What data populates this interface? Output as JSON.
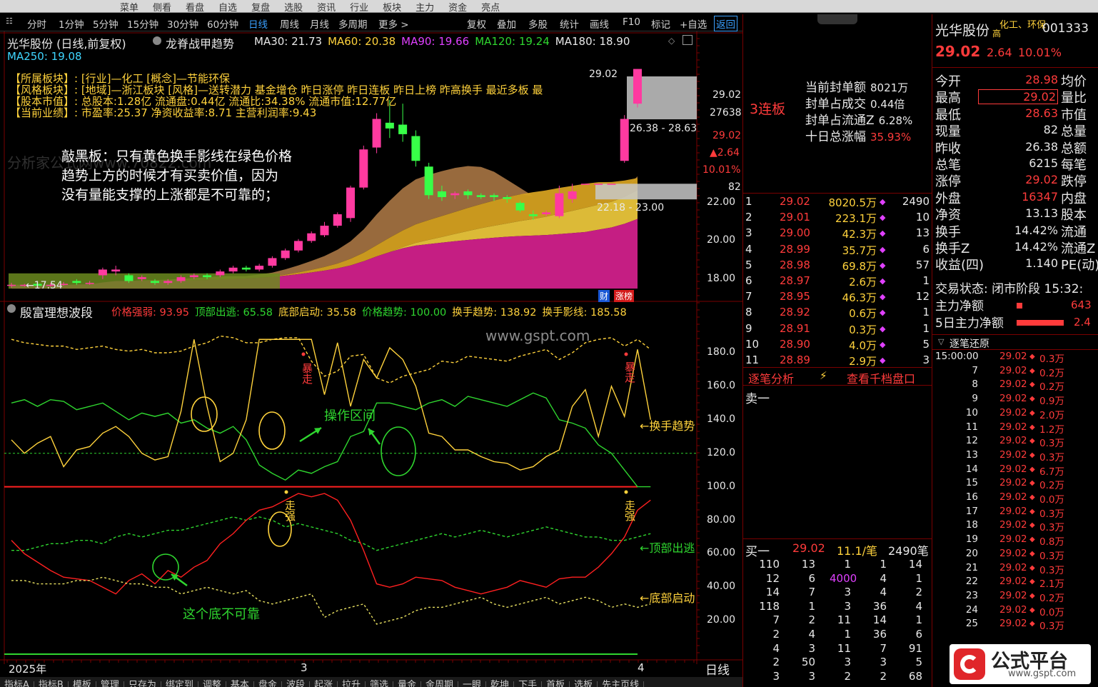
{
  "top_menu": [
    "菜单",
    "侧看",
    "看盘",
    "自选",
    "复盘",
    "选股",
    "资讯",
    "行业",
    "板块",
    "主力",
    "资金",
    "亮点"
  ],
  "period_bar": {
    "periods": [
      "分时",
      "1分钟",
      "5分钟",
      "15分钟",
      "30分钟",
      "60分钟",
      "日线",
      "周线",
      "月线",
      "多周期",
      "更多 >"
    ],
    "active": "日线",
    "tools": [
      "复权",
      "叠加",
      "多股",
      "统计",
      "画线",
      "F10",
      "标记",
      "+自选",
      "返回"
    ]
  },
  "chart_header": {
    "stock_title": "光华股份 (日线,前复权)",
    "indicator_name": "龙脊战甲趋势",
    "ma_values": [
      {
        "label": "MA30: 21.73",
        "color": "#e8e8e8"
      },
      {
        "label": "MA60: 20.38",
        "color": "#ffd23c"
      },
      {
        "label": "MA90: 19.66",
        "color": "#e040ff"
      },
      {
        "label": "MA120: 19.24",
        "color": "#2fd62f"
      },
      {
        "label": "MA180: 18.90",
        "color": "#e8e8e8"
      }
    ],
    "ma250": "MA250: 19.08"
  },
  "info_box": {
    "lines": [
      "【所属板块】: [行业]—化工 [概念]—节能环保",
      "【风格板块】: [地域]—浙江板块 [风格]—送转潜力 基金增仓 昨日涨停 昨日连板 昨日上榜 昨高换手 最近多板 最",
      "【股本市值】: 总股本:1.28亿 流通盘:0.44亿 流通比:34.38% 流通市值:12.77亿",
      "【当前业绩】: 市盈率:25.37 净资收益率:8.71 主营利润率:9.43"
    ]
  },
  "annotation_main": [
    "敲黑板：只有黄色换手影线在绿色价格",
    "趋势上方的时候才有买卖价值，因为",
    "没有量能支撑的上涨都是不可靠的；"
  ],
  "price_chart": {
    "high_label": "29.02",
    "low_label": "17.54",
    "zone1_label": "26.38 - 28.63",
    "zone2_label": "22.18 - 23.00",
    "axis": [
      "22.00",
      "20.00",
      "18.00"
    ],
    "right_labels": {
      "price": "29.02",
      "vol": "27638",
      "cur": "29.02",
      "chg": "▲2.64",
      "pct": "10.01%",
      "v82": "82"
    },
    "badge_cai": "财",
    "badge_zb": "涨榜",
    "candles": [
      {
        "o": 17.7,
        "c": 17.7,
        "h": 17.8,
        "l": 17.55
      },
      {
        "o": 17.7,
        "c": 17.7,
        "h": 17.75,
        "l": 17.6
      },
      {
        "o": 17.75,
        "c": 17.65,
        "h": 17.85,
        "l": 17.6
      },
      {
        "o": 17.7,
        "c": 17.7,
        "h": 17.8,
        "l": 17.6
      },
      {
        "o": 17.7,
        "c": 17.75,
        "h": 17.85,
        "l": 17.65
      },
      {
        "o": 17.9,
        "c": 17.8,
        "h": 18.0,
        "l": 17.7
      },
      {
        "o": 17.8,
        "c": 17.8,
        "h": 17.9,
        "l": 17.7
      },
      {
        "o": 18.2,
        "c": 18.5,
        "h": 18.6,
        "l": 18.0
      },
      {
        "o": 18.4,
        "c": 18.5,
        "h": 18.7,
        "l": 18.2
      },
      {
        "o": 18.2,
        "c": 17.9,
        "h": 18.3,
        "l": 17.8
      },
      {
        "o": 18.0,
        "c": 18.1,
        "h": 18.2,
        "l": 17.9
      },
      {
        "o": 17.9,
        "c": 17.8,
        "h": 18.0,
        "l": 17.7
      },
      {
        "o": 17.8,
        "c": 17.9,
        "h": 18.0,
        "l": 17.7
      },
      {
        "o": 17.9,
        "c": 18.1,
        "h": 18.2,
        "l": 17.8
      },
      {
        "o": 18.1,
        "c": 18.2,
        "h": 18.3,
        "l": 18.0
      },
      {
        "o": 18.2,
        "c": 18.1,
        "h": 18.3,
        "l": 18.0
      },
      {
        "o": 18.2,
        "c": 18.4,
        "h": 18.5,
        "l": 18.1
      },
      {
        "o": 18.4,
        "c": 18.6,
        "h": 18.7,
        "l": 18.3
      },
      {
        "o": 18.6,
        "c": 18.5,
        "h": 18.7,
        "l": 18.4
      },
      {
        "o": 18.5,
        "c": 18.7,
        "h": 18.8,
        "l": 18.4
      },
      {
        "o": 18.7,
        "c": 19.1,
        "h": 19.2,
        "l": 18.6
      },
      {
        "o": 19.1,
        "c": 19.5,
        "h": 19.6,
        "l": 19.0
      },
      {
        "o": 19.5,
        "c": 20.0,
        "h": 20.1,
        "l": 19.4
      },
      {
        "o": 20.0,
        "c": 20.4,
        "h": 20.5,
        "l": 19.9
      },
      {
        "o": 20.3,
        "c": 20.8,
        "h": 21.0,
        "l": 20.2
      },
      {
        "o": 20.8,
        "c": 21.4,
        "h": 21.5,
        "l": 20.7
      },
      {
        "o": 21.2,
        "c": 22.8,
        "h": 22.9,
        "l": 21.0
      },
      {
        "o": 22.8,
        "c": 24.8,
        "h": 25.0,
        "l": 22.7
      },
      {
        "o": 24.9,
        "c": 26.4,
        "h": 26.7,
        "l": 24.6
      },
      {
        "o": 26.2,
        "c": 25.9,
        "h": 27.4,
        "l": 25.4
      },
      {
        "o": 26.1,
        "c": 25.6,
        "h": 27.2,
        "l": 25.2
      },
      {
        "o": 25.5,
        "c": 24.2,
        "h": 25.8,
        "l": 23.9
      },
      {
        "o": 23.9,
        "c": 22.4,
        "h": 24.1,
        "l": 22.2
      },
      {
        "o": 22.6,
        "c": 22.3,
        "h": 22.9,
        "l": 22.1
      },
      {
        "o": 22.4,
        "c": 22.5,
        "h": 22.6,
        "l": 22.2
      },
      {
        "o": 22.6,
        "c": 22.4,
        "h": 22.7,
        "l": 22.2
      },
      {
        "o": 22.4,
        "c": 22.3,
        "h": 22.5,
        "l": 22.2
      },
      {
        "o": 22.4,
        "c": 22.3,
        "h": 22.5,
        "l": 22.1
      },
      {
        "o": 22.3,
        "c": 22.2,
        "h": 22.4,
        "l": 22.0
      },
      {
        "o": 22.0,
        "c": 21.6,
        "h": 22.1,
        "l": 21.5
      },
      {
        "o": 21.4,
        "c": 21.3,
        "h": 21.6,
        "l": 21.1
      },
      {
        "o": 21.4,
        "c": 21.5,
        "h": 21.6,
        "l": 21.3
      },
      {
        "o": 21.3,
        "c": 22.5,
        "h": 22.9,
        "l": 21.2
      },
      {
        "o": 22.2,
        "c": 22.6,
        "h": 23.0,
        "l": 22.0
      },
      {
        "o": 23.0,
        "c": 23.0,
        "h": 23.0,
        "l": 23.0
      },
      {
        "o": 23.0,
        "c": 23.0,
        "h": 23.0,
        "l": 23.0
      },
      {
        "o": 23.0,
        "c": 23.0,
        "h": 23.0,
        "l": 23.0
      },
      {
        "o": 24.2,
        "c": 26.4,
        "h": 26.6,
        "l": 24.1
      },
      {
        "o": 27.2,
        "c": 29.02,
        "h": 29.02,
        "l": 27.0
      }
    ]
  },
  "osc_chart": {
    "title": "殷富理想波段",
    "items": [
      {
        "label": "价格强弱: 93.95",
        "color": "#ff3b3b"
      },
      {
        "label": "顶部出逃: 65.58",
        "color": "#2fd62f"
      },
      {
        "label": "底部启动: 35.58",
        "color": "#ffd23c"
      },
      {
        "label": "价格趋势: 100.00",
        "color": "#2fd62f"
      },
      {
        "label": "换手趋势: 138.92",
        "color": "#ffd23c"
      },
      {
        "label": "换手影线: 185.58",
        "color": "#ffd23c"
      }
    ],
    "axis": [
      "180.0",
      "160.0",
      "140.0",
      "120.0",
      "100.0",
      "80.00",
      "60.00",
      "40.00",
      "20.00"
    ],
    "right_labels": {
      "hs": "←换手趋势",
      "ding": "←顶部出逃",
      "di": "←底部启动"
    },
    "notes": {
      "op_zone": "操作区间",
      "unreliable": "这个底不可靠",
      "baozou": "暴走",
      "zouqiang": "走强"
    },
    "series_yellow": [
      128,
      120,
      126,
      130,
      112,
      122,
      124,
      132,
      136,
      130,
      120,
      116,
      118,
      145,
      188,
      148,
      115,
      120,
      140,
      188,
      188,
      188,
      188,
      188,
      155,
      186,
      148,
      176,
      165,
      183,
      176,
      160,
      132,
      130,
      122,
      122,
      118,
      115,
      114,
      110,
      112,
      118,
      122,
      148,
      158,
      130,
      160,
      142,
      182,
      140
    ],
    "series_green": [
      150,
      152,
      148,
      152,
      151,
      146,
      148,
      150,
      145,
      140,
      144,
      142,
      144,
      138,
      140,
      135,
      132,
      136,
      128,
      113,
      108,
      104,
      110,
      108,
      112,
      115,
      130,
      133,
      150,
      150,
      148,
      146,
      150,
      152,
      148,
      154,
      152,
      150,
      148,
      152,
      156,
      153,
      140,
      138,
      135,
      125,
      120,
      110,
      100,
      100
    ],
    "series_yellow_dash": [
      188,
      186,
      185,
      184,
      184,
      182,
      183,
      184,
      182,
      181,
      182,
      180,
      180,
      181,
      184,
      186,
      190,
      189,
      186,
      186,
      188,
      189,
      189,
      175,
      166,
      169,
      178,
      179,
      165,
      162,
      166,
      168,
      170,
      175,
      174,
      178,
      177,
      176,
      175,
      178,
      180,
      182,
      176,
      180,
      186,
      188,
      189,
      184,
      188,
      182
    ],
    "series_red": [
      68,
      60,
      55,
      50,
      46,
      45,
      44,
      40,
      36,
      44,
      48,
      42,
      50,
      46,
      52,
      56,
      66,
      72,
      80,
      86,
      88,
      92,
      96,
      94,
      96,
      92,
      80,
      62,
      42,
      40,
      42,
      46,
      45,
      44,
      40,
      38,
      36,
      38,
      40,
      44,
      42,
      40,
      45,
      46,
      46,
      52,
      60,
      70,
      86,
      92
    ],
    "series_green_dash": [
      62,
      62,
      64,
      66,
      66,
      68,
      68,
      66,
      70,
      72,
      70,
      72,
      74,
      74,
      76,
      78,
      80,
      82,
      80,
      82,
      80,
      76,
      78,
      76,
      74,
      72,
      68,
      66,
      62,
      64,
      66,
      68,
      70,
      72,
      70,
      72,
      74,
      72,
      70,
      72,
      74,
      76,
      74,
      72,
      70,
      70,
      68,
      68,
      70,
      72
    ],
    "series_white_dash": [
      44,
      44,
      42,
      42,
      42,
      44,
      44,
      46,
      44,
      42,
      42,
      40,
      40,
      36,
      38,
      40,
      38,
      36,
      38,
      32,
      30,
      32,
      34,
      36,
      22,
      26,
      28,
      30,
      18,
      20,
      22,
      26,
      28,
      28,
      30,
      32,
      34,
      30,
      28,
      30,
      32,
      34,
      30,
      32,
      34,
      32,
      28,
      30,
      28,
      30
    ]
  },
  "x_axis": {
    "labels": [
      "2025年",
      "3",
      "4"
    ],
    "right": "日线"
  },
  "bottom_tabs": [
    "指标A",
    "指标B",
    "模板",
    "管理",
    "只存为",
    "绑定到",
    "调整",
    "基本",
    "盘金",
    "波段",
    "起涨",
    "拉升",
    "筛选",
    "量金",
    "金周期",
    "一眼",
    "乾坤",
    "下手",
    "首板",
    "选板",
    "先主页线"
  ],
  "right_panel": {
    "stock_name": "光华股份",
    "tags": "化工、环保",
    "tag_sub": "高",
    "code": "001333",
    "price": "29.02",
    "change": "2.64",
    "pct": "10.01%",
    "limit_board": "3连板",
    "seal_info": [
      {
        "k": "当前封单额",
        "v": "8021万"
      },
      {
        "k": "封单占成交",
        "v": "0.44倍"
      },
      {
        "k": "封单占流通Z",
        "v": "6.28%"
      },
      {
        "k": "十日总涨幅",
        "v": "35.93%"
      }
    ],
    "quotes_left": [
      {
        "k": "今开",
        "v": "28.98",
        "c": "red"
      },
      {
        "k": "最高",
        "v": "29.02",
        "c": "red"
      },
      {
        "k": "最低",
        "v": "28.63",
        "c": "red"
      },
      {
        "k": "现量",
        "v": "82",
        "c": "white"
      },
      {
        "k": "昨收",
        "v": "26.38",
        "c": "white"
      },
      {
        "k": "总笔",
        "v": "6215",
        "c": "white"
      },
      {
        "k": "涨停",
        "v": "29.02",
        "c": "red"
      },
      {
        "k": "外盘",
        "v": "16347",
        "c": "red"
      },
      {
        "k": "净资",
        "v": "13.13",
        "c": "white"
      },
      {
        "k": "换手",
        "v": "14.42%",
        "c": "white"
      },
      {
        "k": "换手Z",
        "v": "14.42%",
        "c": "white"
      },
      {
        "k": "收益(四)",
        "v": "1.140",
        "c": "white"
      }
    ],
    "quotes_right": [
      "均价",
      "量比",
      "市值",
      "总量",
      "总额",
      "每笔",
      "跌停",
      "内盘",
      "股本",
      "流通",
      "流通Z",
      "PE(动)"
    ],
    "trade_status": "交易状态: 闭市阶段 15:32:",
    "main_net": "主力净额",
    "main_net_val": "643",
    "main5_net": "5日主力净额",
    "main5_net_val": "2.4",
    "tick_title": "逐笔还原",
    "ticks": [
      {
        "t": "15:00:00",
        "p": "29.02",
        "v": "0.3万"
      },
      {
        "t": "7",
        "p": "29.02",
        "v": "0.2万"
      },
      {
        "t": "8",
        "p": "29.02",
        "v": "0.2万"
      },
      {
        "t": "9",
        "p": "29.02",
        "v": "0.9万"
      },
      {
        "t": "10",
        "p": "29.02",
        "v": "2.0万"
      },
      {
        "t": "11",
        "p": "29.02",
        "v": "1.2万"
      },
      {
        "t": "12",
        "p": "29.02",
        "v": "0.3万"
      },
      {
        "t": "13",
        "p": "29.02",
        "v": "0.3万"
      },
      {
        "t": "14",
        "p": "29.02",
        "v": "6.7万"
      },
      {
        "t": "15",
        "p": "29.02",
        "v": "0.2万"
      },
      {
        "t": "16",
        "p": "29.02",
        "v": "0.0万"
      },
      {
        "t": "17",
        "p": "29.02",
        "v": "0.3万"
      },
      {
        "t": "18",
        "p": "29.02",
        "v": "0.3万"
      },
      {
        "t": "19",
        "p": "29.02",
        "v": "0.8万"
      },
      {
        "t": "20",
        "p": "29.02",
        "v": "0.3万"
      },
      {
        "t": "21",
        "p": "29.02",
        "v": "0.3万"
      },
      {
        "t": "22",
        "p": "29.02",
        "v": "2.1万"
      },
      {
        "t": "23",
        "p": "29.02",
        "v": "0.2万"
      },
      {
        "t": "24",
        "p": "29.02",
        "v": "0.0万"
      },
      {
        "t": "25",
        "p": "29.02",
        "v": "0.3万"
      }
    ],
    "order_levels": [
      {
        "n": "1",
        "p": "29.02",
        "v": "8020.5万",
        "r": "2490"
      },
      {
        "n": "2",
        "p": "29.01",
        "v": "223.1万",
        "r": "10"
      },
      {
        "n": "3",
        "p": "29.00",
        "v": "42.3万",
        "r": "13"
      },
      {
        "n": "4",
        "p": "28.99",
        "v": "35.7万",
        "r": "6"
      },
      {
        "n": "5",
        "p": "28.98",
        "v": "69.8万",
        "r": "57"
      },
      {
        "n": "6",
        "p": "28.97",
        "v": "2.6万",
        "r": "1"
      },
      {
        "n": "7",
        "p": "28.95",
        "v": "46.3万",
        "r": "12"
      },
      {
        "n": "8",
        "p": "28.92",
        "v": "0.6万",
        "r": "1"
      },
      {
        "n": "9",
        "p": "28.91",
        "v": "0.3万",
        "r": "1"
      },
      {
        "n": "10",
        "p": "28.90",
        "v": "4.0万",
        "r": "5"
      },
      {
        "n": "11",
        "p": "28.89",
        "v": "2.9万",
        "r": "3"
      }
    ],
    "tick_analysis": "逐笔分析",
    "view_depth": "查看千档盘口",
    "sell1": "卖一",
    "buy1": "买一",
    "buy1_price": "29.02",
    "buy1_vol": "11.1/笔",
    "buy1_count": "2490笔",
    "queue": [
      [
        "110",
        "13",
        "1",
        "1",
        "14"
      ],
      [
        "12",
        "6",
        "4000",
        "4",
        "1"
      ],
      [
        "14",
        "7",
        "3",
        "4",
        "2"
      ],
      [
        "118",
        "1",
        "3",
        "36",
        "4"
      ],
      [
        "7",
        "2",
        "11",
        "14",
        "1"
      ],
      [
        "2",
        "4",
        "1",
        "36",
        "6"
      ],
      [
        "4",
        "3",
        "11",
        "7",
        "91"
      ],
      [
        "2",
        "50",
        "3",
        "3",
        "5"
      ],
      [
        "3",
        "3",
        "2",
        "2",
        "68"
      ]
    ]
  },
  "watermark_logo": {
    "name": "公式平台",
    "url": "www.gspt.com"
  },
  "watermark_center": "www.gspt.com",
  "watermark_text": "分析家公式网www.70822.com"
}
